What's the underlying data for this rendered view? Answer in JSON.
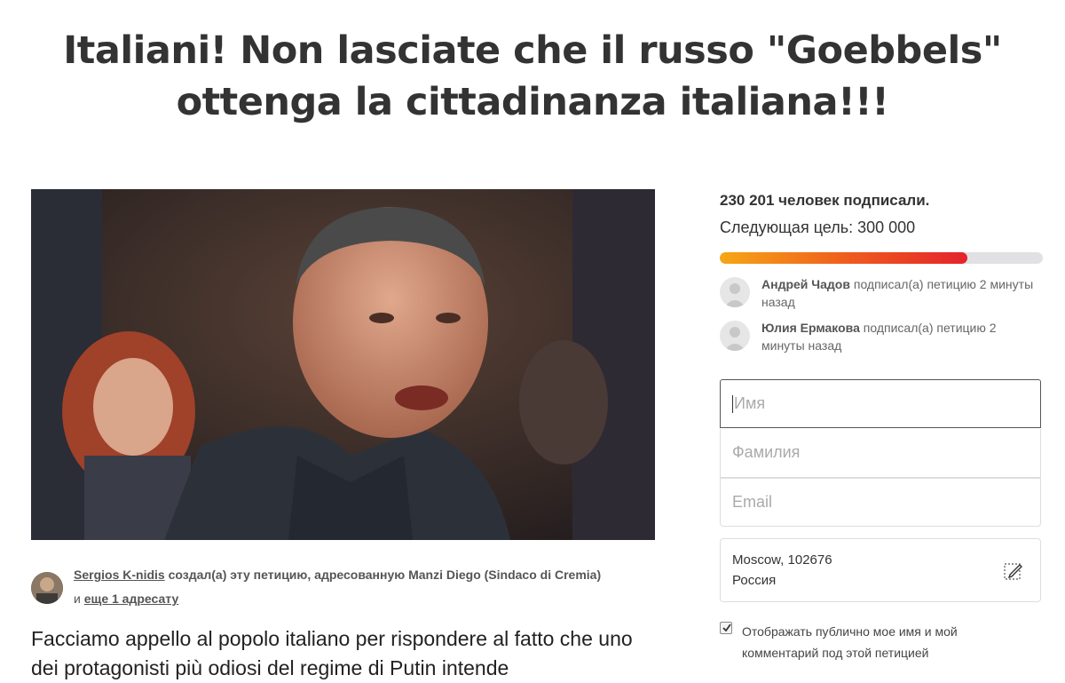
{
  "title": {
    "line1": "Italiani! Non lasciate che il russo \"Goebbels\"",
    "line2": "ottenga la cittadinanza italiana!!!"
  },
  "author": {
    "name": "Sergios K-nidis",
    "created_text": "создал(а) эту петицию, адресованную",
    "recipient": "Manzi Diego (Sindaco di Cremia)",
    "and": "и",
    "more_recipients": "еще 1 адресату"
  },
  "body_text": "Facciamo appello al popolo italiano per rispondere al fatto che uno dei protagonisti più odiosi del regime di Putin intende",
  "stats": {
    "signed": "230 201 человек подписали.",
    "next_goal": "Следующая цель: 300 000",
    "progress_fraction": 0.767
  },
  "recent_signers": [
    {
      "name": "Андрей Чадов",
      "action": "подписал(а) петицию 2 минуты назад"
    },
    {
      "name": "Юлия Ермакова",
      "action": "подписал(а) петицию 2 минуты назад"
    }
  ],
  "form": {
    "first_name_placeholder": "Имя",
    "last_name_placeholder": "Фамилия",
    "email_placeholder": "Email",
    "address_line1": "Moscow, 102676",
    "address_line2": "Россия",
    "public_checkbox_label": "Отображать публично мое имя и мой комментарий под этой петицией",
    "public_checkbox_checked": true
  },
  "colors": {
    "progress_start": "#f7a616",
    "progress_end": "#e4232c",
    "track": "#e1e1e4"
  }
}
